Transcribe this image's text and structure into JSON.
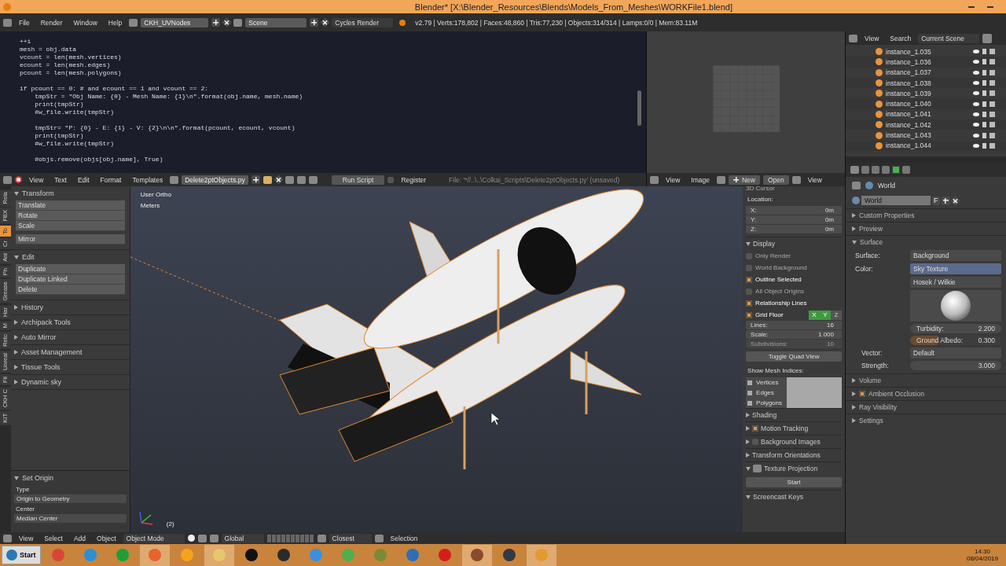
{
  "title_bar": {
    "title": "Blender* [X:\\Blender_Resources\\Blends\\Models_From_Meshes\\WORKFile1.blend]"
  },
  "info_header": {
    "menus": [
      "File",
      "Render",
      "Window",
      "Help"
    ],
    "screen_layout": "CKH_UVNodes",
    "scene": "Scene",
    "render_engine": "Cycles Render",
    "stats": "v2.79 | Verts:178,802 | Faces:48,860 | Tris:77,230 | Objects:314/314 | Lamps:0/0 | Mem:83.11M"
  },
  "text_editor": {
    "blocks": [
      [
        "++i",
        "mesh = obj.data",
        "vcount = len(mesh.vertices)",
        "ecount = len(mesh.edges)",
        "pcount = len(mesh.polygons)"
      ],
      [
        "if pcount == 0: # and ecount == 1 and vcount == 2:",
        "    tmpStr = \"Obj Name: {0} - Mesh Name: {1}\\n\".format(obj.name, mesh.name)",
        "    print(tmpStr)",
        "    #w_file.write(tmpStr)"
      ],
      [
        "    tmpStr= \"P: {0} - E: {1} - V: {2}\\n\\n\".format(pcount, ecount, vcount)",
        "    print(tmpStr)",
        "    #w_file.write(tmpStr)"
      ],
      [
        "    #objs.remove(objs[obj.name], True)"
      ]
    ],
    "menus": [
      "View",
      "Text",
      "Edit",
      "Format",
      "Templates"
    ],
    "file_name": "Delete2ptObjects.py",
    "run_button": "Run Script",
    "register": {
      "label": "Register",
      "checked": false
    },
    "file_path": "File: '*//..\\..\\Colkai_Scripts\\Delete2ptObjects.py' (unsaved)"
  },
  "image_editor": {
    "menus": [
      "View",
      "Image"
    ],
    "new_button": "New",
    "open_button": "Open",
    "view_menu": "View"
  },
  "outliner": {
    "menus": [
      "View",
      "Search"
    ],
    "display_mode": "Current Scene",
    "items": [
      "instance_1.035",
      "instance_1.036",
      "instance_1.037",
      "instance_1.038",
      "instance_1.039",
      "instance_1.040",
      "instance_1.041",
      "instance_1.042",
      "instance_1.043",
      "instance_1.044"
    ]
  },
  "toolshelf": {
    "tabs": [
      {
        "label": "Rela",
        "selected": false
      },
      {
        "label": "FBX",
        "selected": false
      },
      {
        "label": "To",
        "selected": true
      },
      {
        "label": "Cr",
        "selected": false
      },
      {
        "label": "Ani",
        "selected": false
      },
      {
        "label": "Ph",
        "selected": false
      },
      {
        "label": "Grease",
        "selected": false
      },
      {
        "label": "Har",
        "selected": false
      },
      {
        "label": "M",
        "selected": false
      },
      {
        "label": "Reto",
        "selected": false
      },
      {
        "label": "Unreal",
        "selected": false
      },
      {
        "label": "Fil",
        "selected": false
      },
      {
        "label": "CKH C",
        "selected": false
      },
      {
        "label": "KIT",
        "selected": false
      }
    ],
    "panels": [
      {
        "title": "Transform",
        "expanded": true,
        "groups": [
          [
            "Translate",
            "Rotate",
            "Scale"
          ],
          [
            "Mirror"
          ]
        ]
      },
      {
        "title": "Edit",
        "expanded": true,
        "groups": [
          [
            "Duplicate",
            "Duplicate Linked",
            "Delete"
          ]
        ]
      },
      {
        "title": "History",
        "expanded": false
      },
      {
        "title": "Archipack Tools",
        "expanded": false
      },
      {
        "title": "Auto Mirror",
        "expanded": false
      },
      {
        "title": "Asset Management",
        "expanded": false
      },
      {
        "title": "Tissue Tools",
        "expanded": false
      },
      {
        "title": "Dynamic sky",
        "expanded": false
      }
    ],
    "operator": {
      "title": "Set Origin",
      "expanded": true,
      "type_label": "Type",
      "type_value": "Origin to Geometry",
      "center_label": "Center",
      "center_value": "Median Center"
    }
  },
  "viewport": {
    "view_name": "User Ortho",
    "units": "Meters",
    "frame": "(2)"
  },
  "n_panel": {
    "cursor_title": "3D Cursor",
    "location_label": "Location:",
    "location": [
      {
        "axis": "X:",
        "value": "0m"
      },
      {
        "axis": "Y:",
        "value": "0m"
      },
      {
        "axis": "Z:",
        "value": "0m"
      }
    ],
    "display": {
      "title": "Display",
      "expanded": true,
      "options": [
        {
          "label": "Only Render",
          "checked": false
        },
        {
          "label": "World Background",
          "checked": false
        },
        {
          "label": "Outline Selected",
          "checked": true
        },
        {
          "label": "All Object Origins",
          "checked": false
        },
        {
          "label": "Relationship Lines",
          "checked": true
        },
        {
          "label": "Grid Floor",
          "checked": true
        }
      ],
      "grid_axes": [
        {
          "label": "X",
          "on": true
        },
        {
          "label": "Y",
          "on": true
        },
        {
          "label": "Z",
          "on": false
        }
      ],
      "fields": [
        {
          "label": "Lines:",
          "value": "16",
          "disabled": false
        },
        {
          "label": "Scale:",
          "value": "1.000",
          "disabled": false
        },
        {
          "label": "Subdivisions:",
          "value": "10",
          "disabled": true
        }
      ],
      "quad_button": "Toggle Quad View",
      "mesh_indices_label": "Show Mesh Indices:",
      "mesh_indices": [
        "Vertices",
        "Edges",
        "Polygons"
      ]
    },
    "panels": [
      {
        "title": "Shading",
        "kind": "plain",
        "expanded": false
      },
      {
        "title": "Motion Tracking",
        "kind": "checkbox",
        "checked": true,
        "expanded": false
      },
      {
        "title": "Background Images",
        "kind": "checkbox",
        "checked": false,
        "expanded": false
      },
      {
        "title": "Transform Orientations",
        "kind": "plain",
        "expanded": false
      },
      {
        "title": "Texture Projection",
        "kind": "icon",
        "expanded": true
      }
    ],
    "start_button": "Start",
    "last_panel": {
      "title": "Screencast Keys",
      "expanded": true
    }
  },
  "properties": {
    "tabs": [
      {
        "selected": false
      },
      {
        "selected": false
      },
      {
        "selected": false
      },
      {
        "selected": true
      },
      {
        "selected": false
      }
    ],
    "context": "World",
    "world_name": "World",
    "fake_user": "F",
    "panels": [
      {
        "title": "Custom Properties",
        "expanded": false
      },
      {
        "title": "Preview",
        "expanded": false
      },
      {
        "title": "Surface",
        "expanded": true
      }
    ],
    "surface": {
      "surface_label": "Surface:",
      "surface_value": "Background",
      "color_label": "Color:",
      "color_value": "Sky Texture",
      "sky_type": "Hosek / Wilkie",
      "turbidity_label": "Turbidity:",
      "turbidity": "2.200",
      "albedo_label": "Ground Albedo:",
      "albedo": "0.300",
      "albedo_slider": {
        "level": 0.3
      },
      "vector_label": "Vector:",
      "vector_value": "Default",
      "strength_label": "Strength:",
      "strength": "3.000"
    },
    "more_panels": [
      {
        "title": "Volume",
        "kind": "plain",
        "expanded": false
      },
      {
        "title": "Ambient Occlusion",
        "kind": "checkbox",
        "checked": true,
        "expanded": false
      },
      {
        "title": "Ray Visibility",
        "kind": "plain",
        "expanded": false
      },
      {
        "title": "Settings",
        "kind": "plain",
        "expanded": false
      }
    ]
  },
  "view3d_header": {
    "menus": [
      "View",
      "Select",
      "Add",
      "Object"
    ],
    "mode": "Object Mode",
    "orientation": "Global",
    "snap": "Closest",
    "selection_label": "Selection"
  },
  "taskbar": {
    "start": "Start",
    "apps": [
      {
        "color": "#d9453a",
        "active": false
      },
      {
        "color": "#2a8fd6",
        "active": false
      },
      {
        "color": "#1e9e3a",
        "active": false
      },
      {
        "color": "#e8622c",
        "active": true
      },
      {
        "color": "#f7a21b",
        "active": false
      },
      {
        "color": "#e8c66a",
        "active": true
      },
      {
        "color": "#111111",
        "active": false
      },
      {
        "color": "#2b2b2b",
        "active": false
      },
      {
        "color": "#3b8fe0",
        "active": false
      },
      {
        "color": "#4caf50",
        "active": false
      },
      {
        "color": "#7a8a3a",
        "active": false
      },
      {
        "color": "#2d6fb7",
        "active": false
      },
      {
        "color": "#d41e1e",
        "active": false
      },
      {
        "color": "#8a4b2a",
        "active": true
      },
      {
        "color": "#333a44",
        "active": false
      },
      {
        "color": "#e59a2e",
        "active": true
      }
    ],
    "time": "14:30",
    "date": "08/04/2019"
  }
}
